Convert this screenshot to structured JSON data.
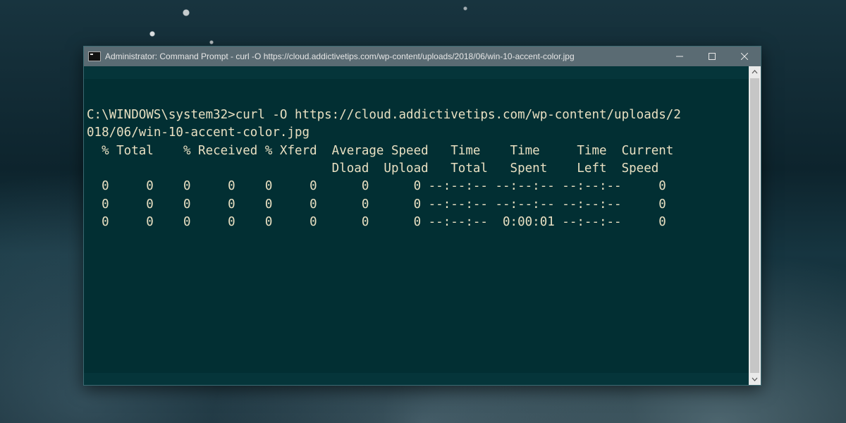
{
  "window": {
    "title": "Administrator: Command Prompt - curl  -O https://cloud.addictivetips.com/wp-content/uploads/2018/06/win-10-accent-color.jpg"
  },
  "terminal": {
    "prompt": "C:\\WINDOWS\\system32>",
    "command": "curl -O https://cloud.addictivetips.com/wp-content/uploads/2018/06/win-10-accent-color.jpg",
    "header_row1": "  % Total    % Received % Xferd  Average Speed   Time    Time     Time  Current",
    "header_row2": "                                 Dload  Upload   Total   Spent    Left  Speed",
    "progress_rows": [
      "  0     0    0     0    0     0      0      0 --:--:-- --:--:-- --:--:--     0",
      "  0     0    0     0    0     0      0      0 --:--:-- --:--:-- --:--:--     0",
      "  0     0    0     0    0     0      0      0 --:--:--  0:00:01 --:--:--     0"
    ]
  },
  "colors": {
    "terminal_bg": "#022f33",
    "terminal_fg": "#e9e0c2",
    "titlebar_bg": "#5a6b73"
  }
}
